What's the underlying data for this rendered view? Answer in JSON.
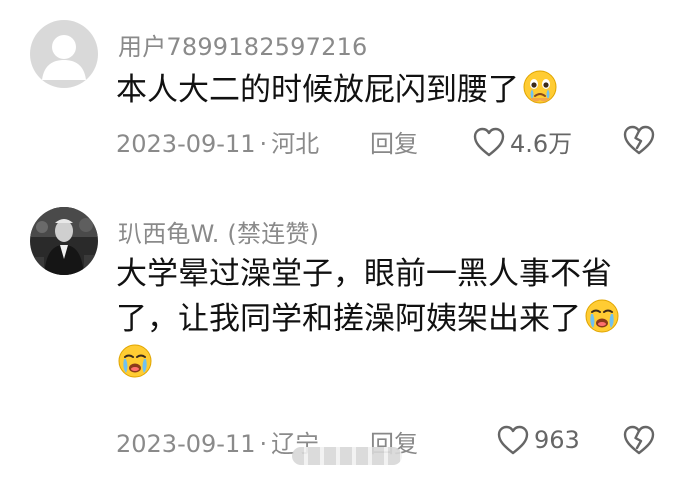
{
  "comments": [
    {
      "username": "用户7899182597216",
      "text": "本人大二的时候放屁闪到腰了",
      "trailing_emoji": "crying-face-emoji",
      "date": "2023-09-11",
      "separator": "·",
      "location": "河北",
      "reply_label": "回复",
      "like_count": "4.6万"
    },
    {
      "username": "玐西龟W. (禁连赞)",
      "text": "大学晕过澡堂子，眼前一黑人事不省了，让我同学和搓澡阿姨架出来了",
      "trailing_emoji": "crying-face-emoji",
      "date": "2023-09-11",
      "separator": "·",
      "location": "辽宁",
      "reply_label": "回复",
      "like_count": "963"
    }
  ],
  "icons": {
    "like": "heart-outline-icon",
    "dislike": "broken-heart-icon"
  },
  "colors": {
    "meta_text": "#8a8a8a",
    "body_text": "#111111",
    "emoji_yellow": "#ffcc33"
  }
}
